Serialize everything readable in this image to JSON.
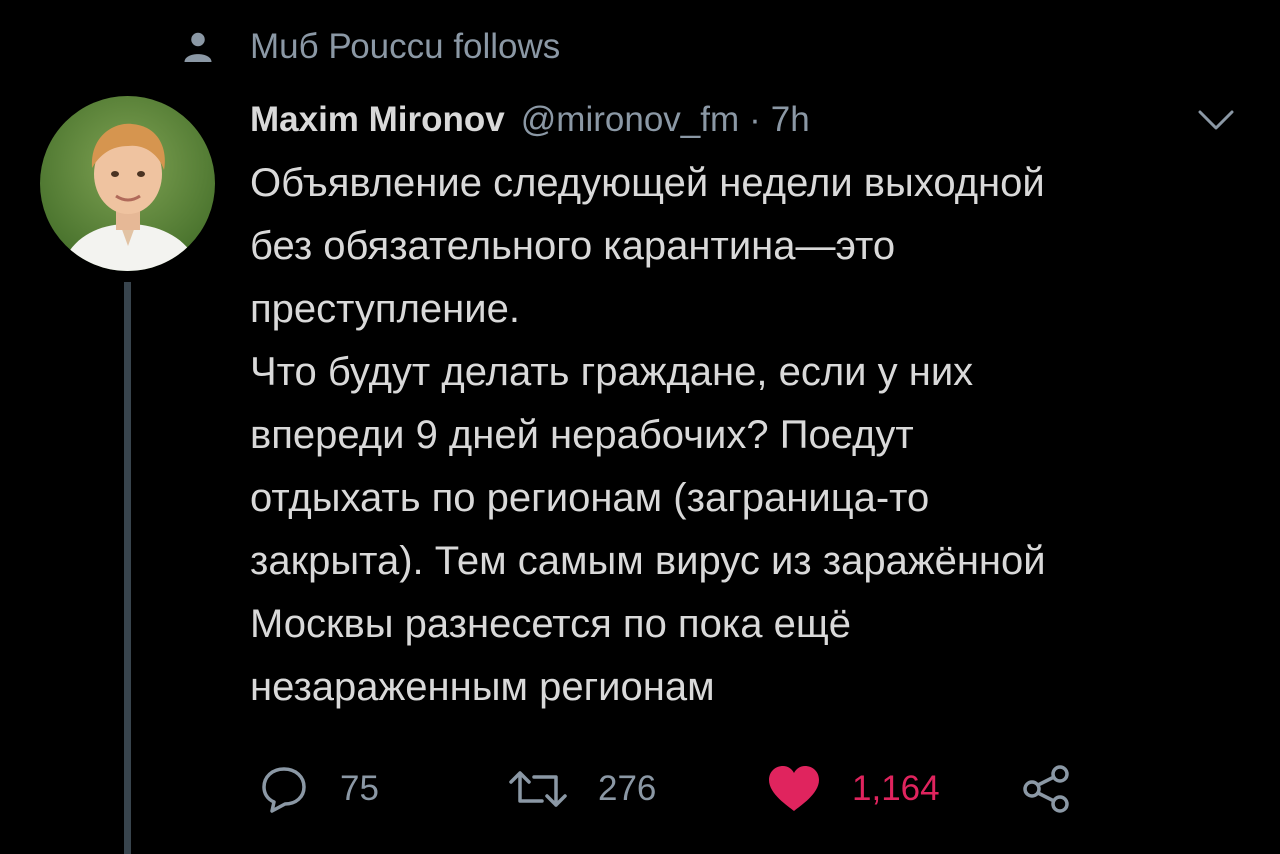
{
  "social_context": {
    "icon": "person-icon",
    "text": "Мuб Роuссu follows"
  },
  "author": {
    "avatar_icon": "avatar-photo",
    "name": "Maxim Mironov",
    "handle": "@mironov_fm",
    "separator": "·",
    "time": "7h"
  },
  "tweet": {
    "lines": [
      "Объявление следующей недели выходной",
      "без обязательного карантина—это",
      "преступление.",
      "Что будут делать граждане, если у них",
      "впереди 9 дней нерабочих? Поедут",
      "отдыхать по регионам (заграница-то",
      "закрыта). Тем самым вирус из заражённой",
      "Москвы разнесется по пока ещё",
      "незараженным регионам"
    ]
  },
  "actions": {
    "reply": {
      "icon": "reply-icon",
      "count": "75"
    },
    "retweet": {
      "icon": "retweet-icon",
      "count": "276"
    },
    "like": {
      "icon": "heart-icon",
      "count": "1,164",
      "liked": true
    },
    "share": {
      "icon": "share-icon"
    }
  },
  "colors": {
    "background": "#000000",
    "primary_text": "#d9d9d9",
    "secondary_text": "#8b98a5",
    "like_active": "#e0245e",
    "thread_line": "#38444d"
  }
}
